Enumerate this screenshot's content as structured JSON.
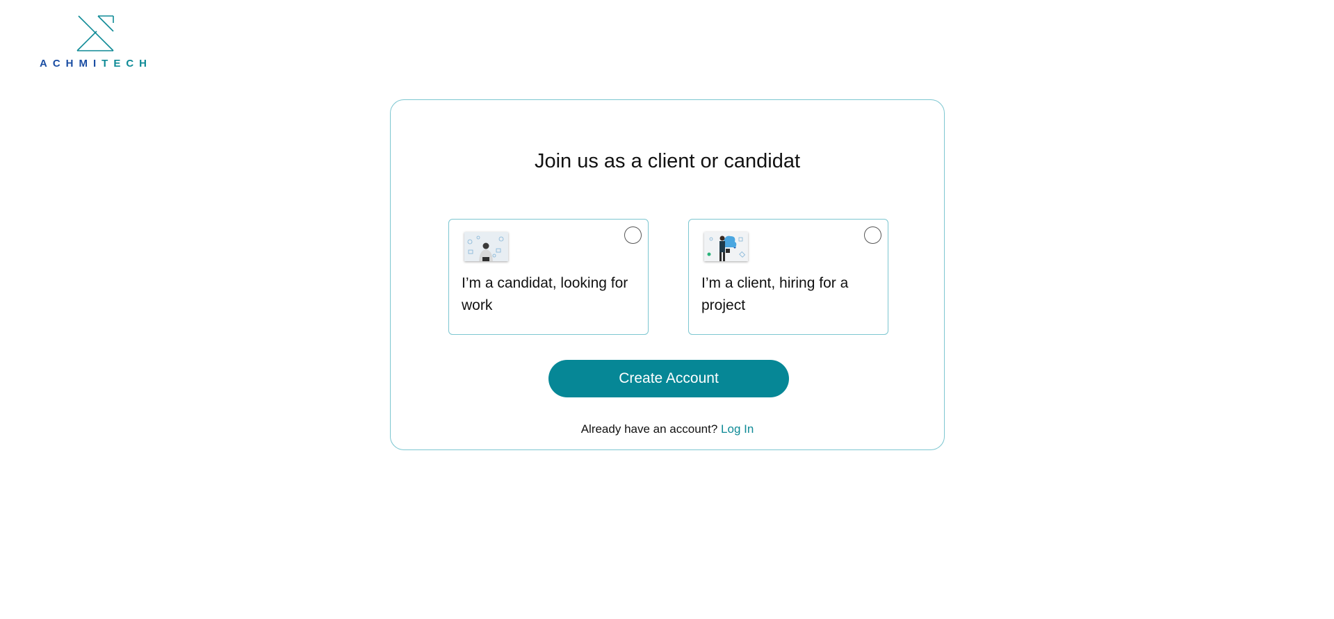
{
  "brand": {
    "logo_icon": "achmitech-logo-icon",
    "name_part1": "ACHMI",
    "name_part2": "TECH",
    "colors": {
      "blue": "#1b4ea3",
      "teal": "#0e8a96"
    }
  },
  "signup": {
    "title": "Join us as a client or candidat",
    "options": [
      {
        "label": "I’m a candidat, looking for work",
        "image": "person-with-tech-icons-image",
        "selected": false
      },
      {
        "label": "I’m a client, hiring for a project",
        "image": "person-with-cloud-image",
        "selected": false
      }
    ],
    "create_button": "Create Account",
    "login_prompt": "Already have an account?",
    "login_link": "Log In"
  },
  "colors": {
    "accent": "#068796",
    "border": "#7cc6d0",
    "text": "#111111",
    "background": "#ffffff"
  }
}
